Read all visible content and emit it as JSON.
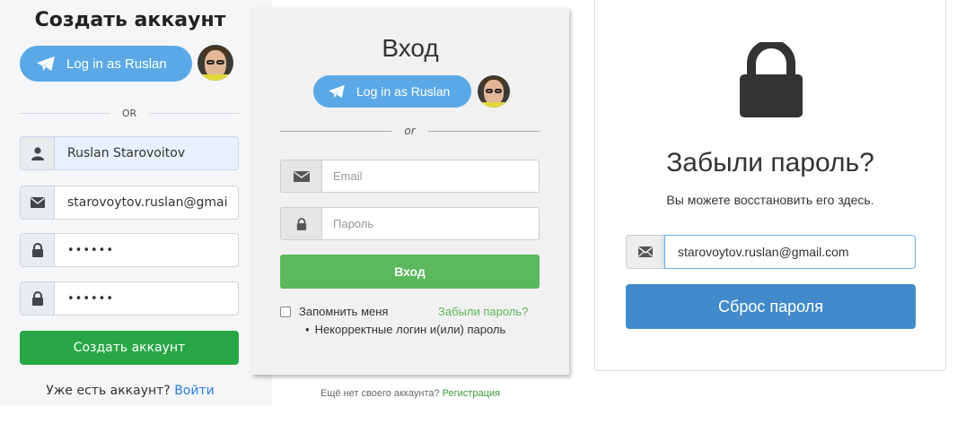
{
  "signup": {
    "title": "Создать аккаунт",
    "telegram_button": "Log in as Ruslan",
    "or_label": "OR",
    "name_value": "Ruslan Starovoitov",
    "email_value": "starovoytov.ruslan@gmai",
    "password1_value": "••••••",
    "password2_value": "••••••",
    "submit_label": "Создать аккаунт",
    "have_account_text": "Уже есть аккаунт?",
    "login_link": "Войти"
  },
  "login": {
    "title": "Вход",
    "telegram_button": "Log in as Ruslan",
    "or_label": "or",
    "email_placeholder": "Email",
    "password_placeholder": "Пароль",
    "submit_label": "Вход",
    "remember_label": "Запомнить меня",
    "forgot_link": "Забыли пароль?",
    "error_message": "Некорректные логин и(или) пароль",
    "no_account_text": "Ещё нет своего аккаунта?",
    "register_link": "Регистрация"
  },
  "reset": {
    "title": "Забыли пароль?",
    "subtitle": "Вы можете восстановить его здесь.",
    "email_value": "starovoytov.ruslan@gmail.com",
    "submit_label": "Сброс пароля"
  },
  "icons": {
    "telegram": "telegram-plane-icon",
    "user": "user-icon",
    "envelope": "envelope-icon",
    "lock": "lock-icon",
    "big_lock": "padlock-icon"
  },
  "colors": {
    "telegram_blue": "#5aa9e6",
    "signup_green": "#28a745",
    "login_green": "#5cb85c",
    "reset_blue": "#428bca",
    "link_blue": "#2b7de9"
  }
}
